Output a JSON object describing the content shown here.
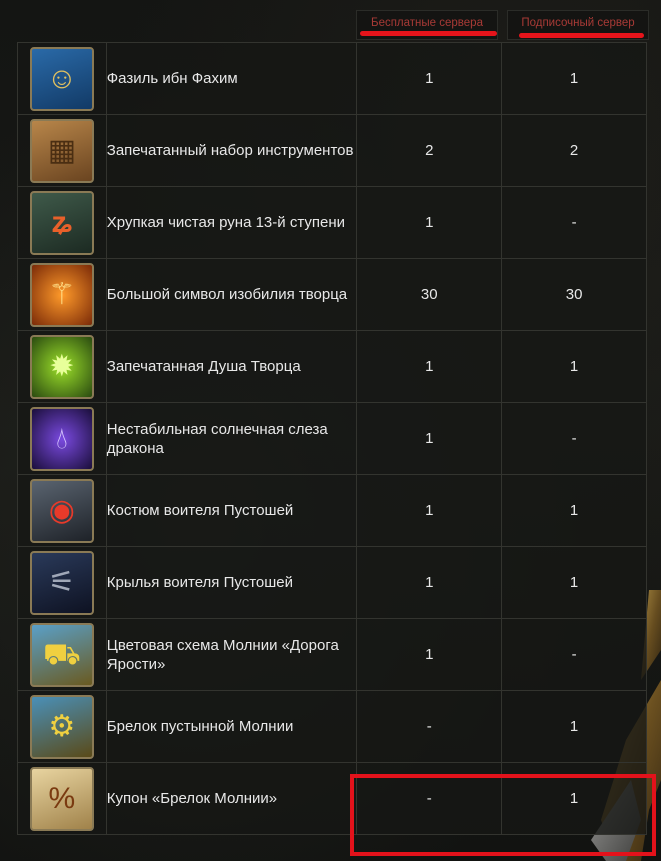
{
  "headers": {
    "free_servers": "Бесплатные сервера",
    "subscription_server": "Подписочный сервер"
  },
  "colors": {
    "header_text": "#a83a36",
    "highlight": "#e3121b",
    "cell_border": "#33342f"
  },
  "rows": [
    {
      "name": "Фазиль ибн Фахим",
      "free": "1",
      "sub": "1",
      "icon": "turbaned-merchant-icon"
    },
    {
      "name": "Запечатанный набор инструментов",
      "free": "2",
      "sub": "2",
      "icon": "wooden-crate-icon"
    },
    {
      "name": "Хрупкая чистая руна 13-й ступени",
      "free": "1",
      "sub": "-",
      "icon": "rune-stone-icon"
    },
    {
      "name": "Большой символ изобилия творца",
      "free": "30",
      "sub": "30",
      "icon": "golden-symbol-icon"
    },
    {
      "name": "Запечатанная Душа Творца",
      "free": "1",
      "sub": "1",
      "icon": "green-soul-gem-icon"
    },
    {
      "name": "Нестабильная солнечная слеза дракона",
      "free": "1",
      "sub": "-",
      "icon": "purple-tear-icon"
    },
    {
      "name": "Костюм воителя Пустошей",
      "free": "1",
      "sub": "1",
      "icon": "armor-costume-icon"
    },
    {
      "name": "Крылья воителя Пустошей",
      "free": "1",
      "sub": "1",
      "icon": "wasteland-wings-icon"
    },
    {
      "name": "Цветовая схема Молнии «Дорога Ярости»",
      "free": "1",
      "sub": "-",
      "icon": "vehicle-colorscheme-icon"
    },
    {
      "name": "Брелок пустынной Молнии",
      "free": "-",
      "sub": "1",
      "icon": "vehicle-keychain-icon"
    },
    {
      "name": "Купон «Брелок Молнии»",
      "free": "-",
      "sub": "1",
      "icon": "coupon-icon"
    }
  ]
}
